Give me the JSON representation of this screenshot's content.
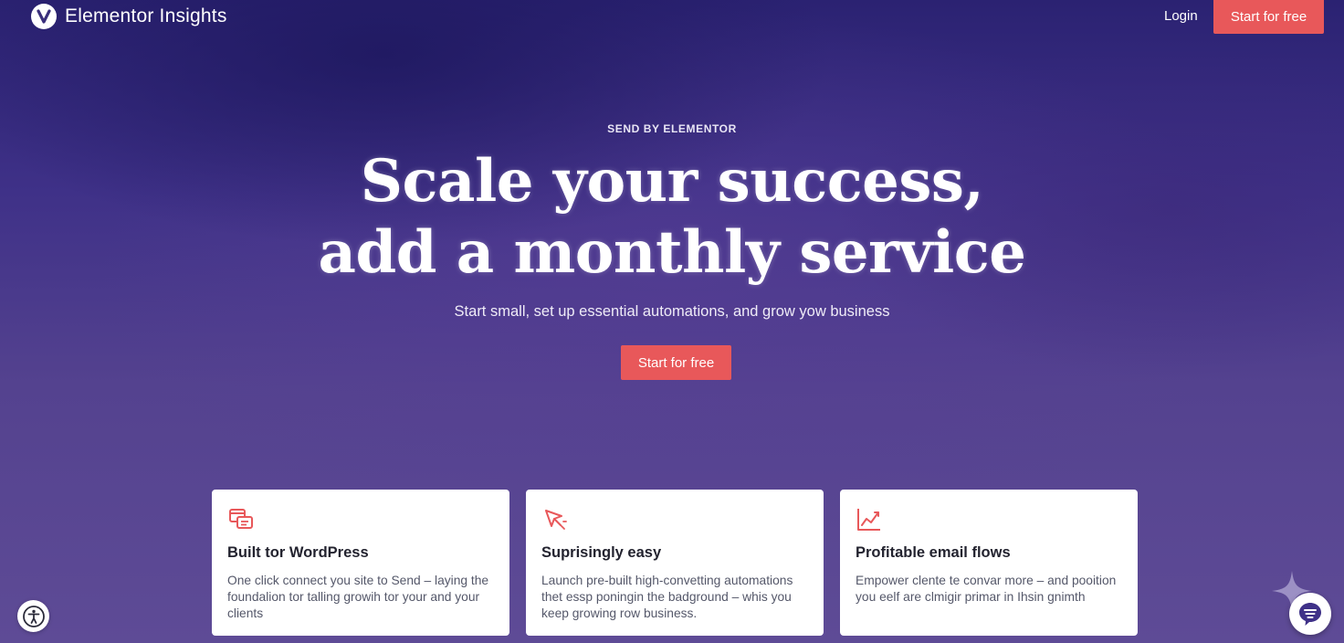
{
  "header": {
    "brand_name": "Elementor Insights",
    "login_label": "Login",
    "cta_label": "Start for free"
  },
  "hero": {
    "eyebrow": "SEND BY ELEMENTOR",
    "headline_line1": "Scale your success,",
    "headline_line2": "add a monthly service",
    "subhead": "Start small, set up essential automations, and grow yow business",
    "cta_label": "Start for free"
  },
  "features": [
    {
      "icon": "chat-windows-icon",
      "title": "Built tor WordPress",
      "body_line1": "One click connect you site to Send – laying the",
      "body_line2": "foundalion tor talling growih tor your and your",
      "body_line3": "clients"
    },
    {
      "icon": "cursor-click-icon",
      "title": "Suprisingly easy",
      "body_line1": "Launch pre-built high-convetting automations",
      "body_line2": "thet essp poningin the badground – whis you",
      "body_line3": "keep growing row business."
    },
    {
      "icon": "line-chart-icon",
      "title": "Profitable email flows",
      "body_line1": "Empower clente te convar more – and pooition",
      "body_line2": "you eelf are clmigir primar in Ihsin gnimth",
      "body_line3": ""
    }
  ],
  "colors": {
    "accent": "#e8585a",
    "background_top": "#2b2272",
    "background_bottom": "#5e4b96",
    "card_text": "#55586a",
    "card_title": "#23232f"
  },
  "widgets": {
    "accessibility_icon": "accessibility-icon",
    "chat_icon": "chat-bubble-icon",
    "sparkle_icon": "sparkle-icon"
  }
}
